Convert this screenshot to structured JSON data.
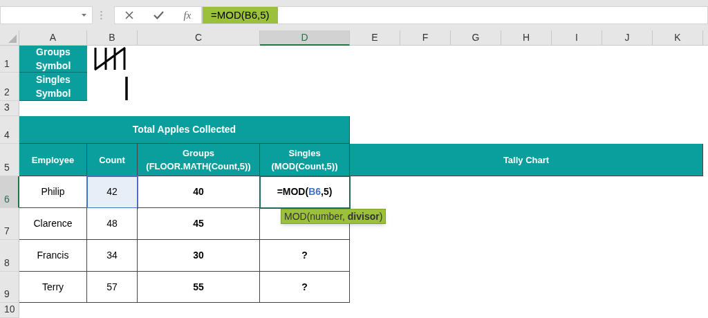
{
  "formula_bar": {
    "fx_label": "fx",
    "formula": "=MOD(B6,5)"
  },
  "column_headers": [
    {
      "label": "A",
      "selected": false
    },
    {
      "label": "B",
      "selected": false
    },
    {
      "label": "C",
      "selected": false
    },
    {
      "label": "D",
      "selected": true
    },
    {
      "label": "E",
      "selected": false
    },
    {
      "label": "F",
      "selected": false
    },
    {
      "label": "G",
      "selected": false
    },
    {
      "label": "H",
      "selected": false
    },
    {
      "label": "I",
      "selected": false
    },
    {
      "label": "J",
      "selected": false
    },
    {
      "label": "K",
      "selected": false
    }
  ],
  "row_headers": [
    {
      "label": "1",
      "selected": false
    },
    {
      "label": "2",
      "selected": false
    },
    {
      "label": "3",
      "selected": false
    },
    {
      "label": "4",
      "selected": false
    },
    {
      "label": "5",
      "selected": false
    },
    {
      "label": "6",
      "selected": true
    },
    {
      "label": "7",
      "selected": false
    },
    {
      "label": "8",
      "selected": false
    },
    {
      "label": "9",
      "selected": false
    },
    {
      "label": "10",
      "selected": false
    }
  ],
  "legend": [
    {
      "label": "Groups Symbol",
      "kind": "group"
    },
    {
      "label": "Singles Symbol",
      "kind": "single"
    }
  ],
  "table": {
    "title": "Total Apples Collected",
    "columns": [
      "Employee",
      "Count",
      "Groups (FLOOR.MATH(Count,5))",
      "Singles (MOD(Count,5))",
      "Tally Chart"
    ],
    "rows": [
      {
        "employee": "Philip",
        "count": "42",
        "count_selected": true,
        "groups": "40",
        "editing": true,
        "singles_parts": [
          {
            "text": "=MOD(",
            "ref": false
          },
          {
            "text": "B6",
            "ref": true
          },
          {
            "text": ",5)",
            "ref": false
          }
        ]
      },
      {
        "employee": "Clarence",
        "count": "48",
        "count_selected": false,
        "groups": "45",
        "editing": false
      },
      {
        "employee": "Francis",
        "count": "34",
        "count_selected": false,
        "groups": "30",
        "editing": false,
        "singles": "?"
      },
      {
        "employee": "Terry",
        "count": "57",
        "count_selected": false,
        "groups": "55",
        "editing": false,
        "singles": "?"
      }
    ]
  },
  "tooltip": "MOD(number, **divisor**)"
}
